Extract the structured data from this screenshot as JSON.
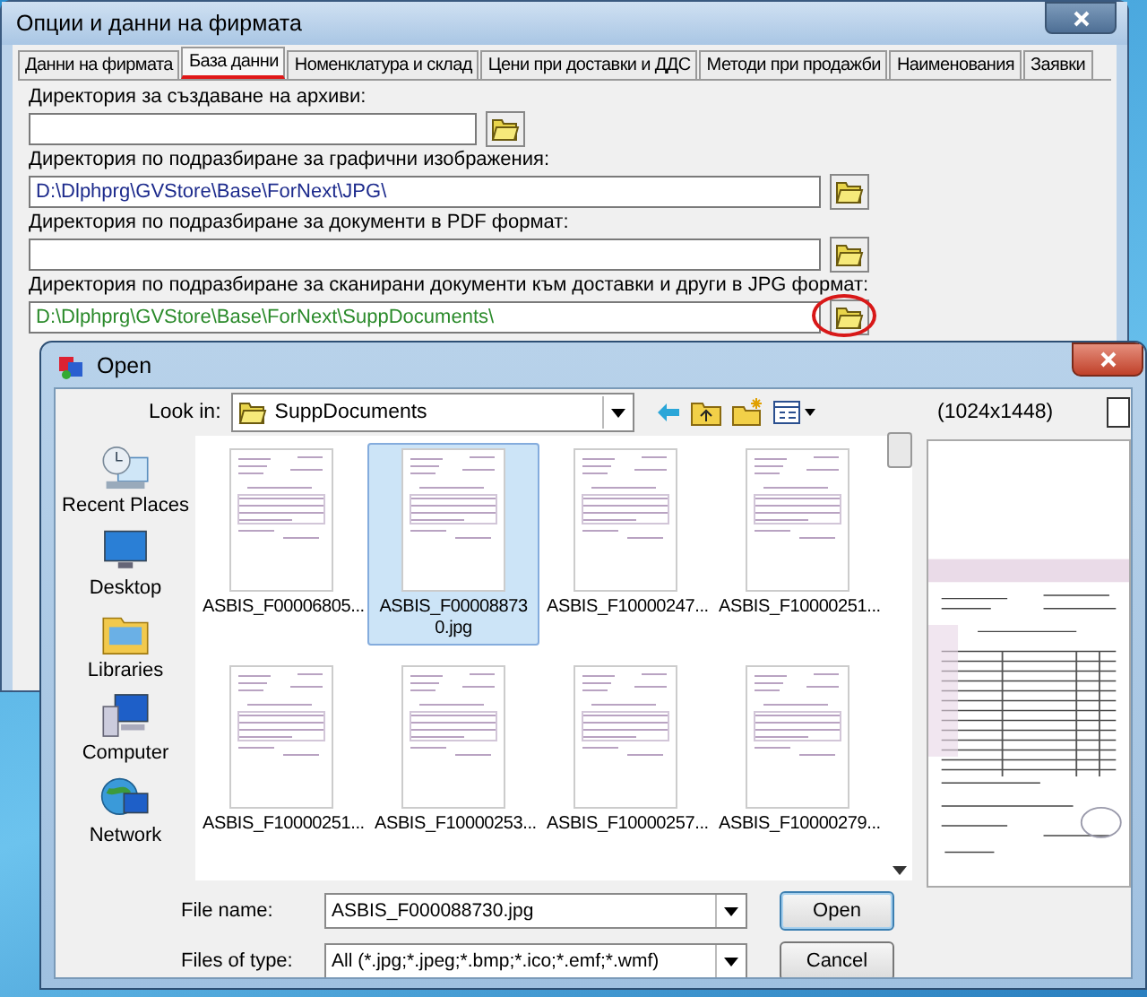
{
  "main_window": {
    "title": "Опции и данни на фирмата",
    "tabs": [
      {
        "label": "Данни на фирмата",
        "selected": false
      },
      {
        "label": "База данни",
        "selected": true
      },
      {
        "label": "Номенклатура и склад",
        "selected": false
      },
      {
        "label": "Цени при доставки и ДДС",
        "selected": false
      },
      {
        "label": "Методи при продажби",
        "selected": false
      },
      {
        "label": "Наименования",
        "selected": false
      },
      {
        "label": "Заявки",
        "selected": false
      }
    ],
    "fields": [
      {
        "label": "Директория за създаване на архиви:",
        "wide": false,
        "highlighted": false
      },
      {
        "label": "Директория по подразбиране за графични изображения:",
        "value": "D:\\Dlphprg\\GVStore\\Base\\ForNext\\JPG\\",
        "color": "#1c2a8c",
        "wide": true,
        "highlighted": false
      },
      {
        "label": "Директория по подразбиране за документи в PDF формат:",
        "wide": true,
        "highlighted": false
      },
      {
        "label": "Директория по подразбиране за сканирани документи към доставки и други в JPG формат:",
        "value": "D:\\Dlphprg\\GVStore\\Base\\ForNext\\SuppDocuments\\",
        "color": "#2a8a2a",
        "wide": true,
        "highlighted": true
      }
    ]
  },
  "open_dialog": {
    "title": "Open",
    "look_in": {
      "label": "Look in:",
      "value": "SuppDocuments"
    },
    "image_size": "(1024x1448)",
    "places": [
      {
        "label": "Recent Places",
        "kind": "recent"
      },
      {
        "label": "Desktop",
        "kind": "desktop"
      },
      {
        "label": "Libraries",
        "kind": "libraries"
      },
      {
        "label": "Computer",
        "kind": "computer"
      },
      {
        "label": "Network",
        "kind": "network"
      }
    ],
    "files": [
      {
        "name": "ASBIS_F00006805...",
        "selected": false
      },
      {
        "name": "ASBIS_F000088730.jpg",
        "selected": true
      },
      {
        "name": "ASBIS_F10000247...",
        "selected": false
      },
      {
        "name": "ASBIS_F10000251...",
        "selected": false
      },
      {
        "name": "ASBIS_F10000251...",
        "selected": false
      },
      {
        "name": "ASBIS_F10000253...",
        "selected": false
      },
      {
        "name": "ASBIS_F10000257...",
        "selected": false
      },
      {
        "name": "ASBIS_F10000279...",
        "selected": false
      }
    ],
    "file_name": {
      "label": "File name:",
      "value": "ASBIS_F000088730.jpg"
    },
    "file_type": {
      "label": "Files of type:",
      "value": "All (*.jpg;*.jpeg;*.bmp;*.ico;*.emf;*.wmf)"
    },
    "buttons": [
      "Open",
      "Cancel"
    ]
  }
}
